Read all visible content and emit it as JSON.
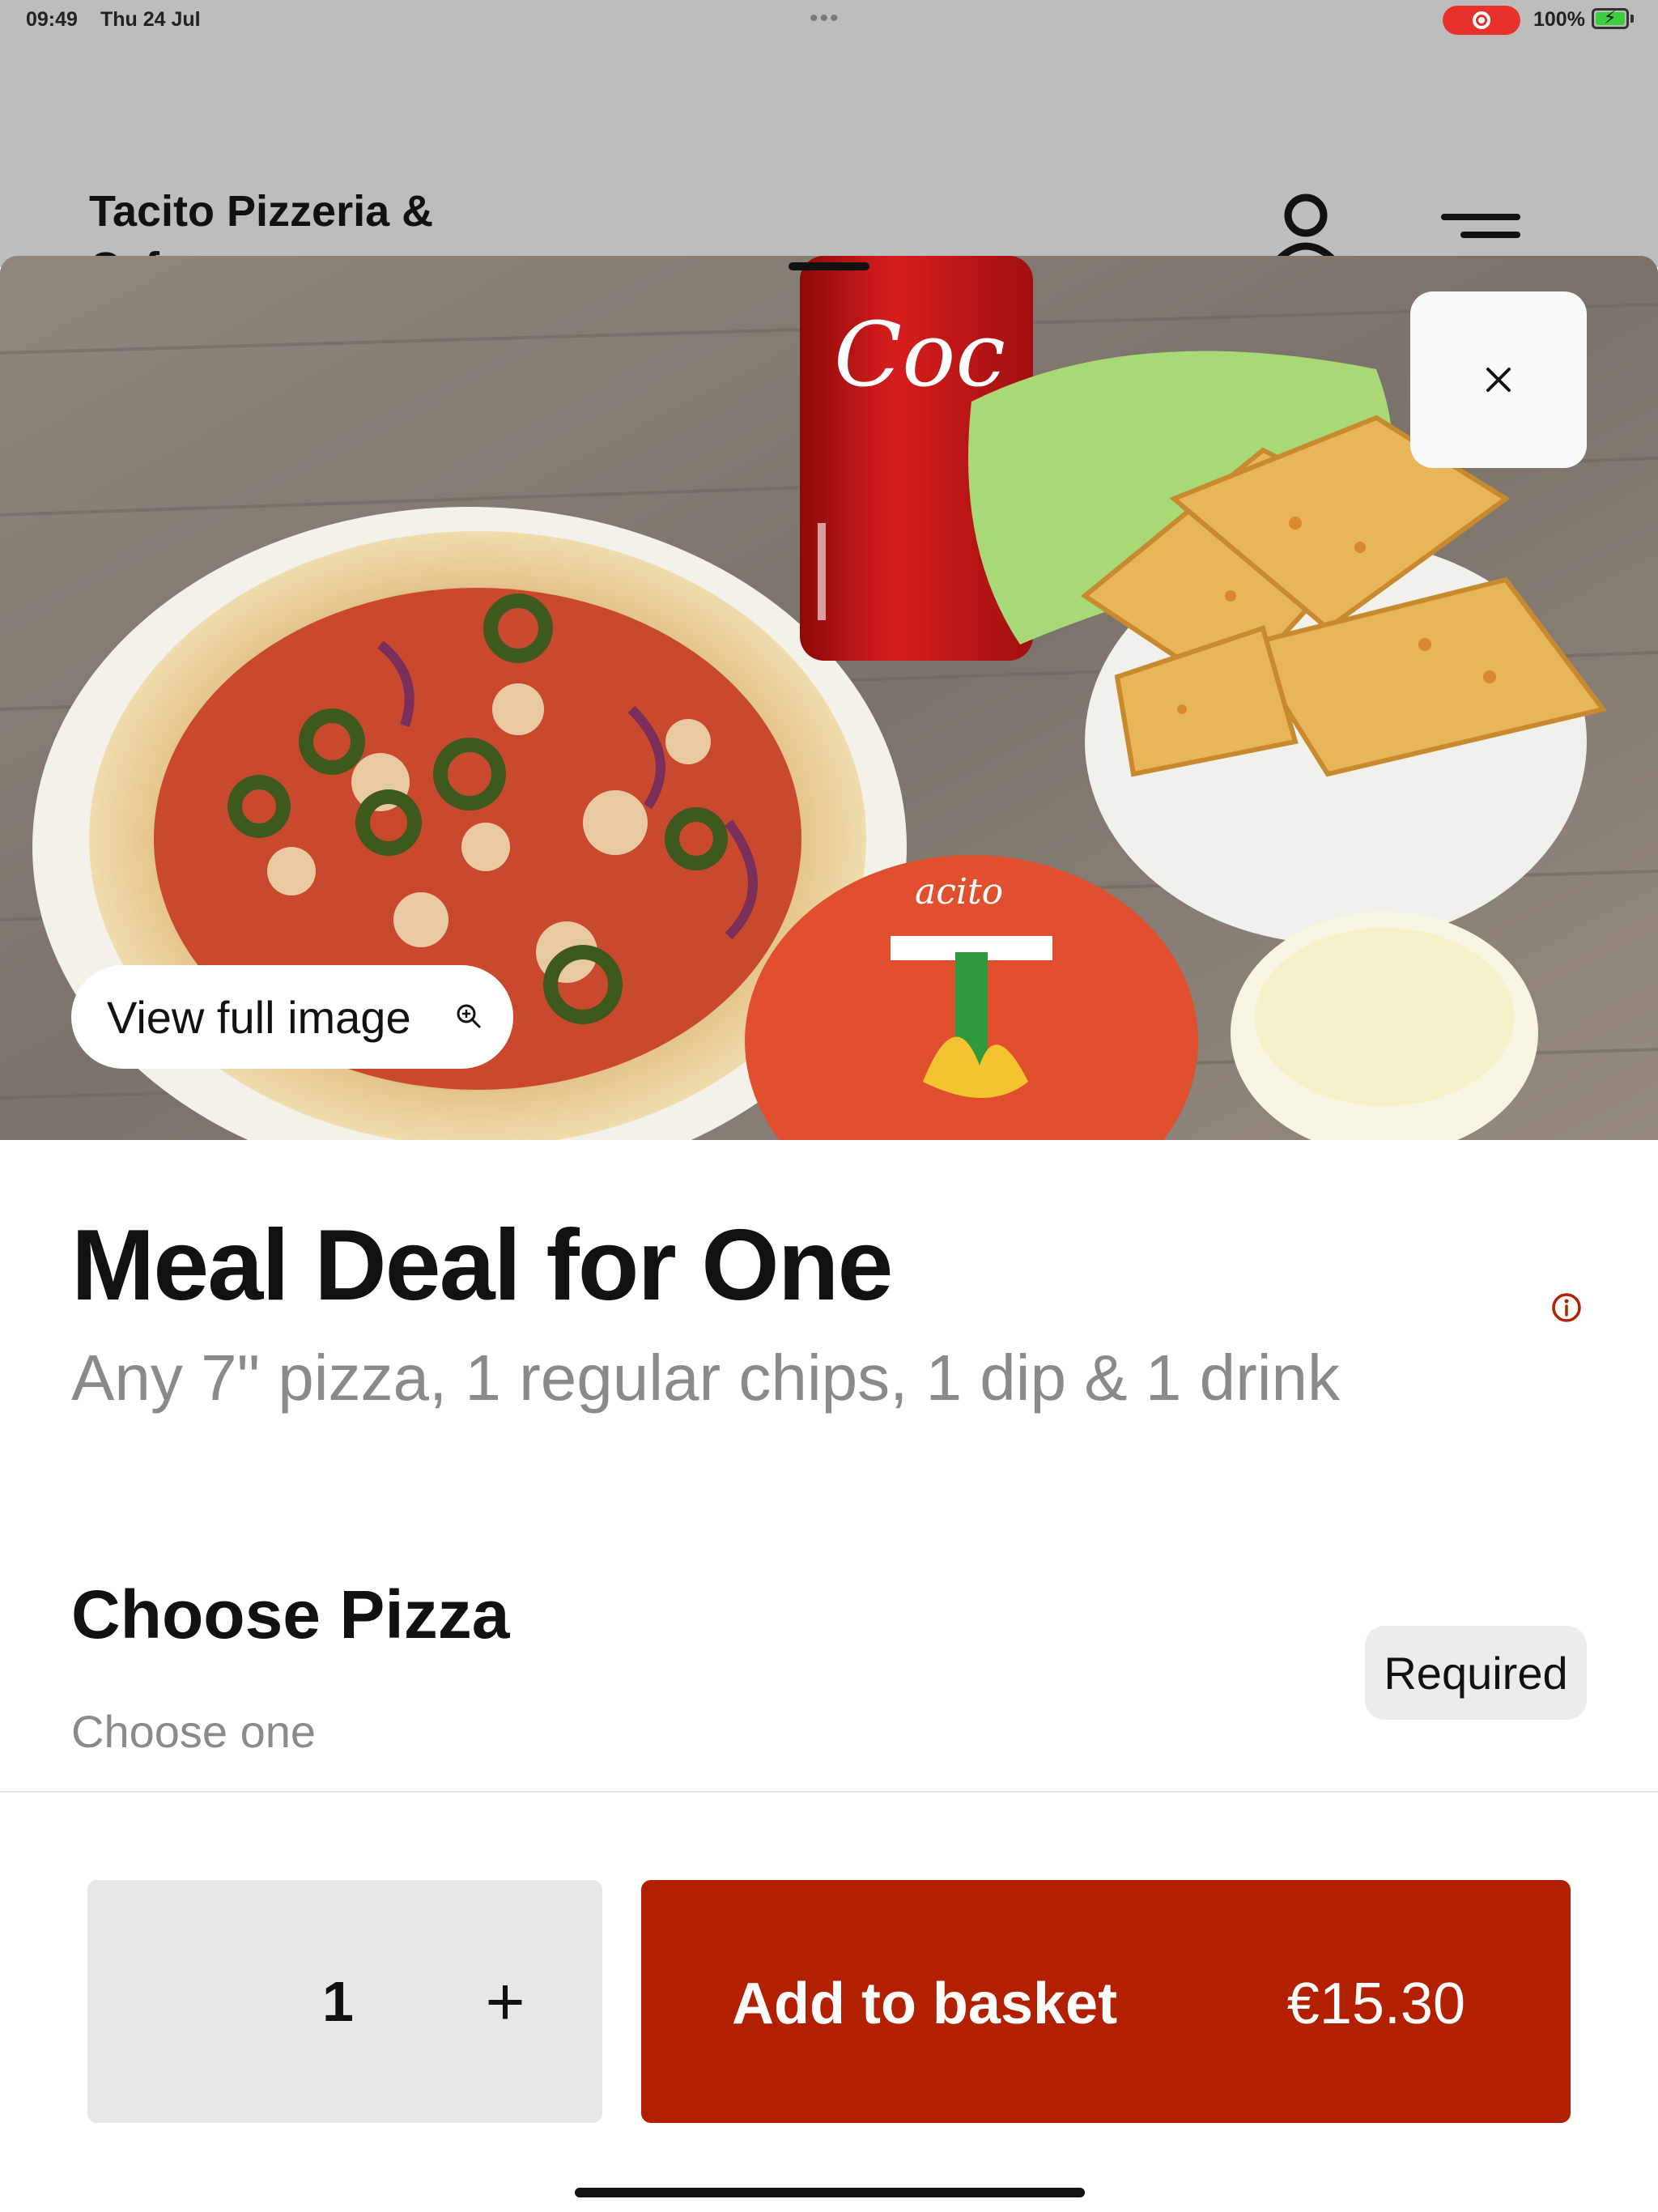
{
  "status_bar": {
    "time": "09:49",
    "date": "Thu 24 Jul",
    "battery": "100%"
  },
  "background_header": {
    "title": "Tacito Pizzeria & Cafe"
  },
  "item": {
    "view_full_image": "View full image",
    "title": "Meal Deal for One",
    "description": "Any 7\" pizza, 1 regular chips, 1 dip & 1 drink"
  },
  "section": {
    "title": "Choose Pizza",
    "subtitle": "Choose one",
    "badge": "Required"
  },
  "footer": {
    "quantity": "1",
    "plus": "+",
    "add_label": "Add to basket",
    "price": "€15.30"
  },
  "icons": {
    "close": "close-icon",
    "zoom": "zoom-in-icon",
    "info": "info-icon",
    "user": "user-icon",
    "menu": "menu-icon"
  },
  "colors": {
    "accent": "#b22000",
    "info": "#b22000",
    "recording": "#e8312b"
  }
}
